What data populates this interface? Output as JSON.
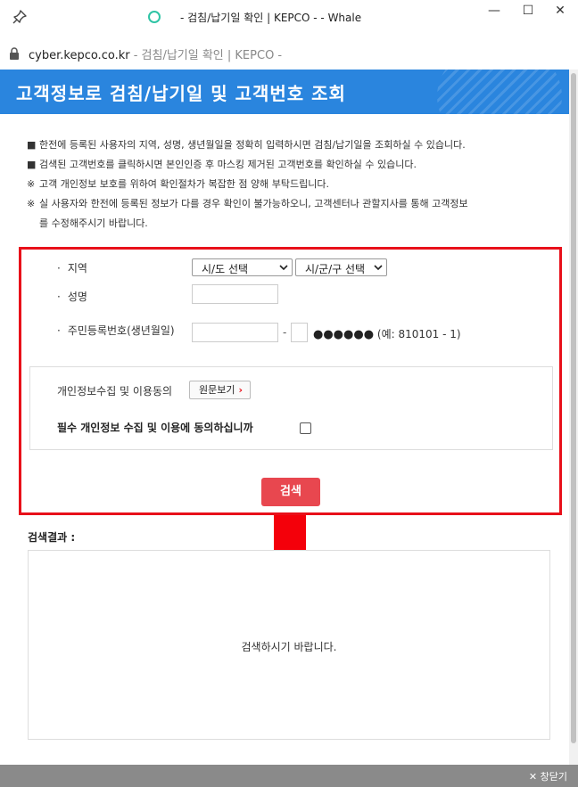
{
  "window": {
    "title": "- 검침/납기일 확인 | KEPCO - - Whale",
    "minimize_glyph": "—",
    "maximize_glyph": "☐",
    "close_glyph": "✕"
  },
  "address_bar": {
    "domain": "cyber.kepco.co.kr",
    "page_title": " - 검침/납기일 확인 | KEPCO -"
  },
  "banner": {
    "title": "고객정보로 검침/납기일 및 고객번호 조회",
    "color": "#2a85de"
  },
  "notices": [
    {
      "marker": "■",
      "text": "한전에 등록된 사용자의 지역, 성명, 생년월일을 정확히 입력하시면 검침/납기일을 조회하실 수 있습니다."
    },
    {
      "marker": "■",
      "text": "검색된 고객번호를 클릭하시면 본인인증 후 마스킹 제거된 고객번호를 확인하실 수 있습니다."
    },
    {
      "marker": "※",
      "text": "고객 개인정보 보호를 위하여 확인절차가 복잡한 점 양해 부탁드립니다."
    },
    {
      "marker": "※",
      "text": "실 사용자와 한전에 등록된 정보가 다를 경우 확인이 불가능하오니, 고객센터나 관할지사를 통해 고객정보",
      "continuation": "를 수정해주시기 바랍니다."
    }
  ],
  "form": {
    "bullet": "·",
    "region": {
      "label": "지역",
      "province_select": "시/도 선택",
      "city_select": "시/군/구 선택"
    },
    "name": {
      "label": "성명",
      "value": ""
    },
    "rrn": {
      "label": "주민등록번호(생년월일)",
      "front_value": "",
      "back_first_digit": "",
      "separator": "-",
      "masked_dots": "●●●●●●",
      "example": "(예: 810101 - 1)"
    },
    "consent": {
      "label": "개인정보수집 및 이용동의",
      "view_button": "원문보기",
      "view_arrow": "›",
      "agree_label": "필수 개인정보 수집 및 이용에 동의하십니까",
      "agree_checked": false
    },
    "search_button": "검색",
    "highlight_color": "#e8101a",
    "button_color": "#e8474f"
  },
  "results": {
    "title": "검색결과 :",
    "message": "검색하시기 바랍니다."
  },
  "footer": {
    "close_label": "✕ 창닫기"
  }
}
